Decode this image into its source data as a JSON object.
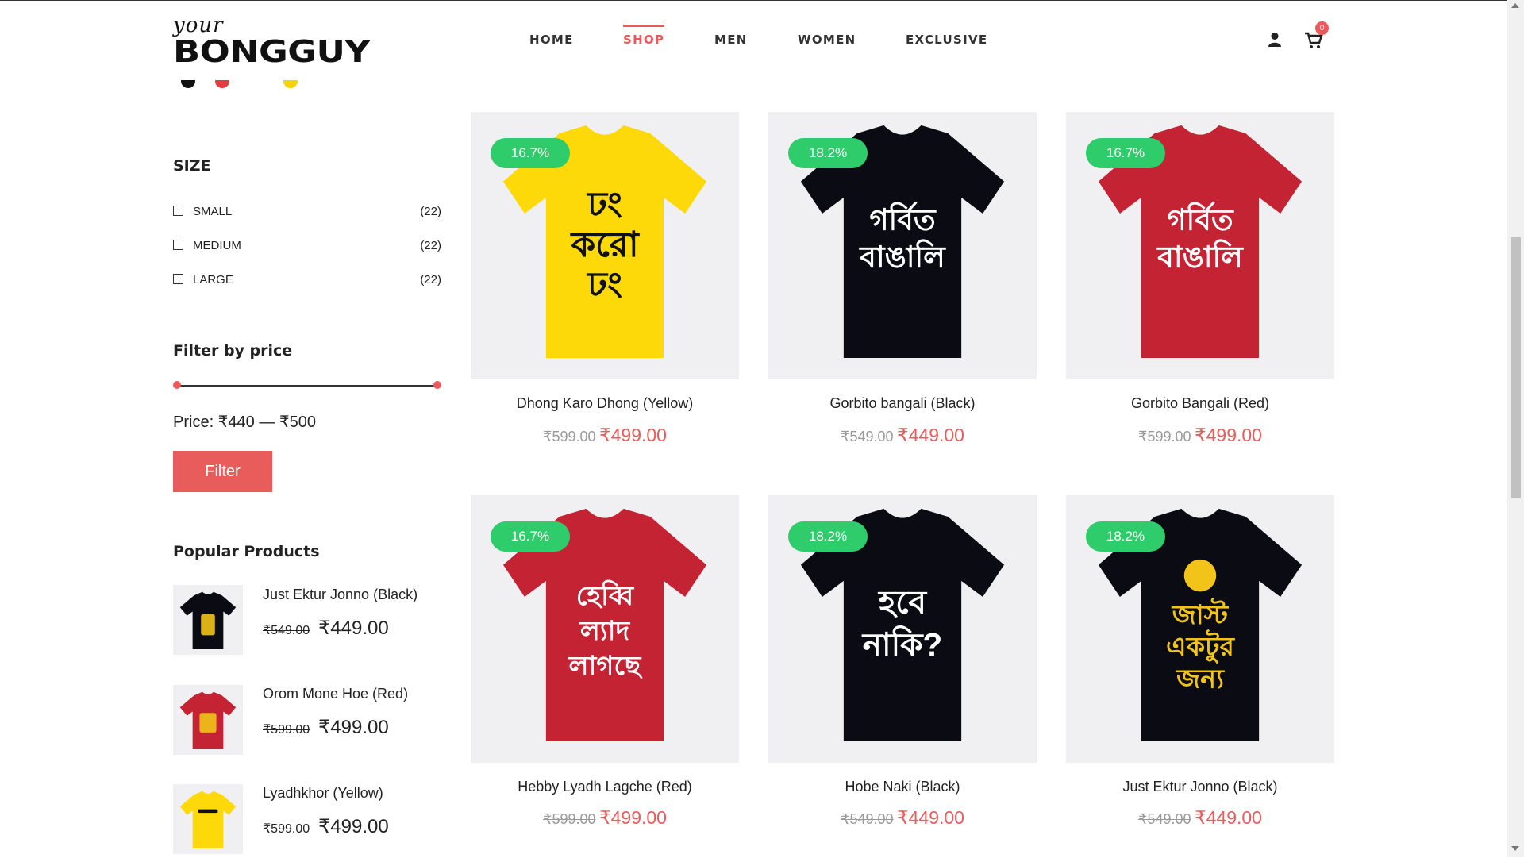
{
  "header": {
    "logo_top": "your",
    "logo_main": "BONGGUY",
    "nav": [
      "HOME",
      "SHOP",
      "MEN",
      "WOMEN",
      "EXCLUSIVE"
    ],
    "active_nav": "SHOP",
    "cart_count": "0"
  },
  "color_swatches": [
    "#111111",
    "#e23c3c",
    "#f7d400"
  ],
  "sidebar": {
    "size_heading": "SIZE",
    "sizes": [
      {
        "label": "SMALL",
        "count": "(22)"
      },
      {
        "label": "MEDIUM",
        "count": "(22)"
      },
      {
        "label": "LARGE",
        "count": "(22)"
      }
    ],
    "price_heading": "Filter by price",
    "price_label": "Price: ₹440 — ₹500",
    "filter_button": "Filter",
    "popular_heading": "Popular Products",
    "popular": [
      {
        "title": "Just Ektur Jonno (Black)",
        "old": "₹549.00",
        "new": "₹449.00",
        "shirt_color": "#0b0b14",
        "print_color": "#f2c318"
      },
      {
        "title": "Orom Mone Hoe (Red)",
        "old": "₹599.00",
        "new": "₹499.00",
        "shirt_color": "#c42334",
        "print_color": "#f2c318"
      },
      {
        "title": "Lyadhkhor (Yellow)",
        "old": "₹599.00",
        "new": "₹499.00",
        "shirt_color": "#fed90a",
        "print_color": "#111111"
      }
    ]
  },
  "products": [
    {
      "badge": "16.7%",
      "title": "Dhong Karo Dhong (Yellow)",
      "old": "₹599.00",
      "new": "₹499.00",
      "shirt_color": "#fed90a",
      "print": [
        "ঢং",
        "করো",
        "ঢং"
      ],
      "print_color": "#111111"
    },
    {
      "badge": "18.2%",
      "title": "Gorbito bangali (Black)",
      "old": "₹549.00",
      "new": "₹449.00",
      "shirt_color": "#0b0b14",
      "print": [
        "গর্বিত",
        "বাঙালি"
      ],
      "print_color": "#ffffff"
    },
    {
      "badge": "16.7%",
      "title": "Gorbito Bangali (Red)",
      "old": "₹599.00",
      "new": "₹499.00",
      "shirt_color": "#c42334",
      "print": [
        "গর্বিত",
        "বাঙালি"
      ],
      "print_color": "#ffffff"
    },
    {
      "badge": "16.7%",
      "title": "Hebby Lyadh Lagche (Red)",
      "old": "₹599.00",
      "new": "₹499.00",
      "shirt_color": "#c42334",
      "print": [
        "হেব্বি",
        "ল্যাদ",
        "লাগছে"
      ],
      "print_color": "#ffffff"
    },
    {
      "badge": "18.2%",
      "title": "Hobe Naki (Black)",
      "old": "₹549.00",
      "new": "₹449.00",
      "shirt_color": "#0b0b14",
      "print": [
        "হবে",
        "নাকি?"
      ],
      "print_color": "#ffffff"
    },
    {
      "badge": "18.2%",
      "title": "Just Ektur Jonno (Black)",
      "old": "₹549.00",
      "new": "₹449.00",
      "shirt_color": "#0b0b14",
      "print": [
        "জাস্ট",
        "একটুর",
        "জন্য"
      ],
      "print_color": "#f2c318"
    }
  ],
  "colors": {
    "accent": "#e95c5c",
    "badge": "#2fcc6b",
    "card_bg": "#f0eff1"
  }
}
